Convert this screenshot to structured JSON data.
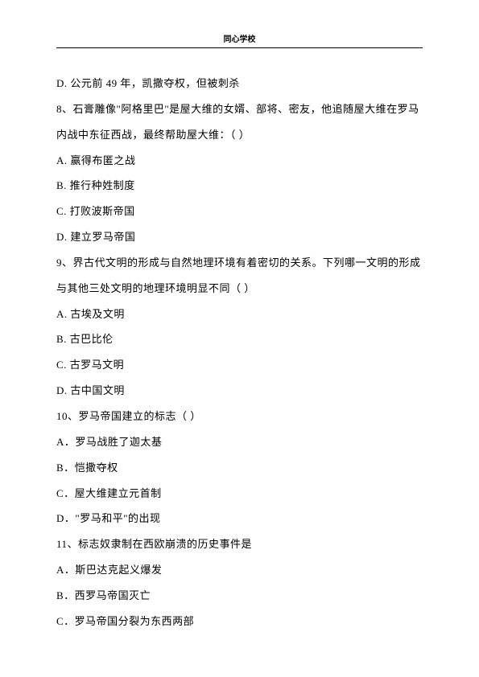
{
  "header": "同心学校",
  "lines": {
    "l0": "D. 公元前 49 年，凯撒夺权，但被刺杀",
    "q8_num": "8",
    "q8_text": "石膏雕像\"阿格里巴\"是屋大维的女婿、部将、密友，他追随屋大维在罗马内战中东征西战，最终帮助屋大维：（   ）",
    "q8_a": "A. 赢得布匿之战",
    "q8_b": "B. 推行种姓制度",
    "q8_c": "C. 打败波斯帝国",
    "q8_d": "D. 建立罗马帝国",
    "q9_num": "9",
    "q9_text": "界古代文明的形成与自然地理环境有着密切的关系。下列哪一文明的形成与其他三处文明的地理环境明显不同（    ）",
    "q9_a": "A. 古埃及文明",
    "q9_b": "B. 古巴比伦",
    "q9_c": "C. 古罗马文明",
    "q9_d": "D. 古中国文明",
    "q10_num": "10",
    "q10_text": "罗马帝国建立的标志（   ）",
    "q10_a": "A．罗马战胜了迦太基",
    "q10_b": "B．恺撒夺权",
    "q10_c": "C．屋大维建立元首制",
    "q10_d": "D．\"罗马和平\"的出现",
    "q11_num": "11",
    "q11_text": "标志奴隶制在西欧崩溃的历史事件是",
    "q11_a": "A．斯巴达克起义爆发",
    "q11_b": "B．西罗马帝国灭亡",
    "q11_c": "C．罗马帝国分裂为东西两部"
  }
}
